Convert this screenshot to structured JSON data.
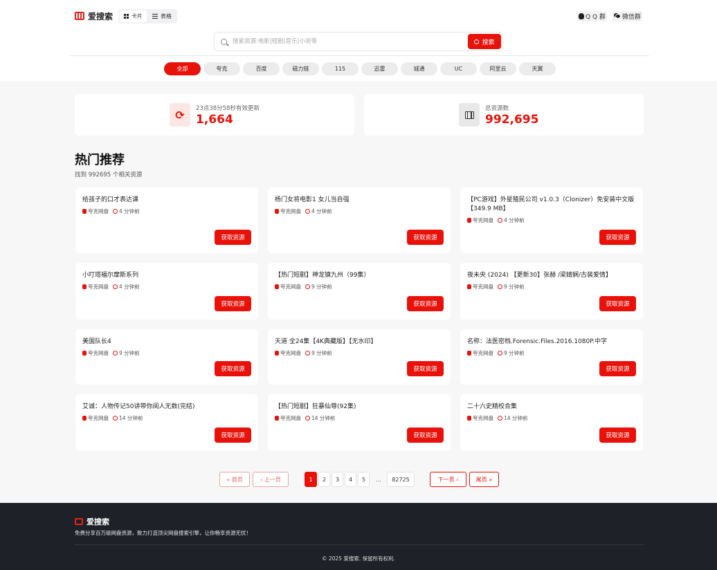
{
  "brand": {
    "name": "爱搜索",
    "accent": "#e8120a"
  },
  "view_toggle": {
    "card_label": "卡片",
    "table_label": "表格",
    "active": "card"
  },
  "groups": {
    "qq": "Q Q 群",
    "wechat": "微信群"
  },
  "search": {
    "placeholder": "搜索资源:电影|短剧|音乐|小说等",
    "button": "搜索"
  },
  "filters": [
    "全部",
    "夸克",
    "百度",
    "磁力链",
    "115",
    "迅雷",
    "城通",
    "UC",
    "阿里云",
    "天翼"
  ],
  "active_filter": "全部",
  "stats": {
    "updated_label": "23点38分58秒有效更新",
    "updated_count": "1,664",
    "total_label": "总资源数",
    "total_count": "992,695"
  },
  "section": {
    "title": "热门推荐",
    "subtitle": "找到 992695 个相关资源"
  },
  "get_button_label": "获取资源",
  "cards": [
    {
      "title": "给孩子的口才表达课",
      "source": "夸克网盘",
      "time": "4 分钟前"
    },
    {
      "title": "杨门女将电影1 女儿当自强",
      "source": "夸克网盘",
      "time": "4 分钟前"
    },
    {
      "title": "【PC游戏】外星殖民公司 v1.0.3（Clonizer）免安装中文版【349.9 MB】",
      "source": "夸克网盘",
      "time": "4 分钟前"
    },
    {
      "title": "小叮塔福尔摩斯系列",
      "source": "夸克网盘",
      "time": "4 分钟前"
    },
    {
      "title": "【热门短剧】神龙镇九州（99集）",
      "source": "夸克网盘",
      "time": "9 分钟前"
    },
    {
      "title": "夜未央 (2024) 【更新30】张赫 /梁婧娴/古装爱情】",
      "source": "夸克网盘",
      "time": "9 分钟前"
    },
    {
      "title": "美国队长4",
      "source": "夸克网盘",
      "time": "9 分钟前"
    },
    {
      "title": "天道 全24集【4K典藏版】【无水印】",
      "source": "夸克网盘",
      "time": "9 分钟前"
    },
    {
      "title": "名称：法医密档.Forensic.Files.2016.1080P.中字",
      "source": "夸克网盘",
      "time": "9 分钟前"
    },
    {
      "title": "艾诚：人物传记50讲带你阅人无数(完结)",
      "source": "夸克网盘",
      "time": "14 分钟前"
    },
    {
      "title": "【热门短剧】狂暴仙尊(92集)",
      "source": "夸克网盘",
      "time": "14 分钟前"
    },
    {
      "title": "二十六史精校合集",
      "source": "夸克网盘",
      "time": "14 分钟前"
    }
  ],
  "pagination": {
    "first": "« 首页",
    "prev": "‹ 上一页",
    "pages": [
      "1",
      "2",
      "3",
      "4",
      "5"
    ],
    "current": 1,
    "ellipsis": "...",
    "last_page": "82725",
    "next": "下一页 ›",
    "last": "尾页 »"
  },
  "footer": {
    "brand": "爱搜索",
    "description": "免费分享百万级网盘资源，致力打造顶尖网盘搜索引擎，让你畅享资源无忧！",
    "copyright": "© 2025 爱搜索. 保留所有权利."
  }
}
